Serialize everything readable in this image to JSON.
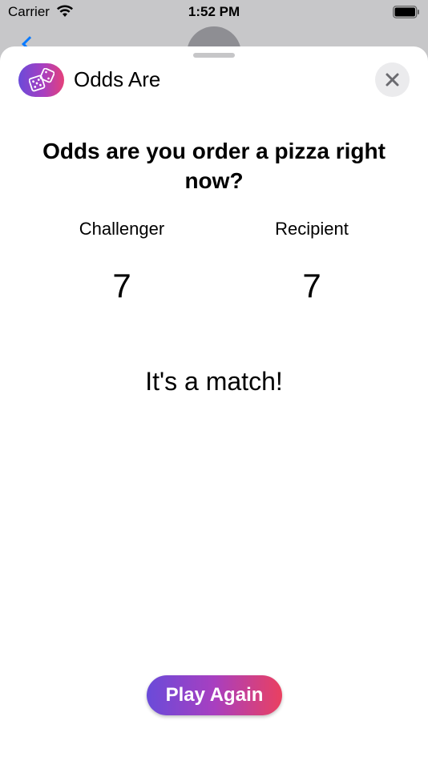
{
  "status_bar": {
    "carrier": "Carrier",
    "time": "1:52 PM"
  },
  "header": {
    "app_name": "Odds Are",
    "icons": {
      "app": "dice-icon",
      "close": "close-icon"
    }
  },
  "game": {
    "question": "Odds are you order a pizza right now?",
    "challenger_label": "Challenger",
    "recipient_label": "Recipient",
    "challenger_value": "7",
    "recipient_value": "7",
    "result": "It's a match!"
  },
  "actions": {
    "play_again_label": "Play Again"
  },
  "colors": {
    "gradient_start": "#6a4bd9",
    "gradient_end": "#ea4060",
    "close_bg": "#ebebed"
  }
}
